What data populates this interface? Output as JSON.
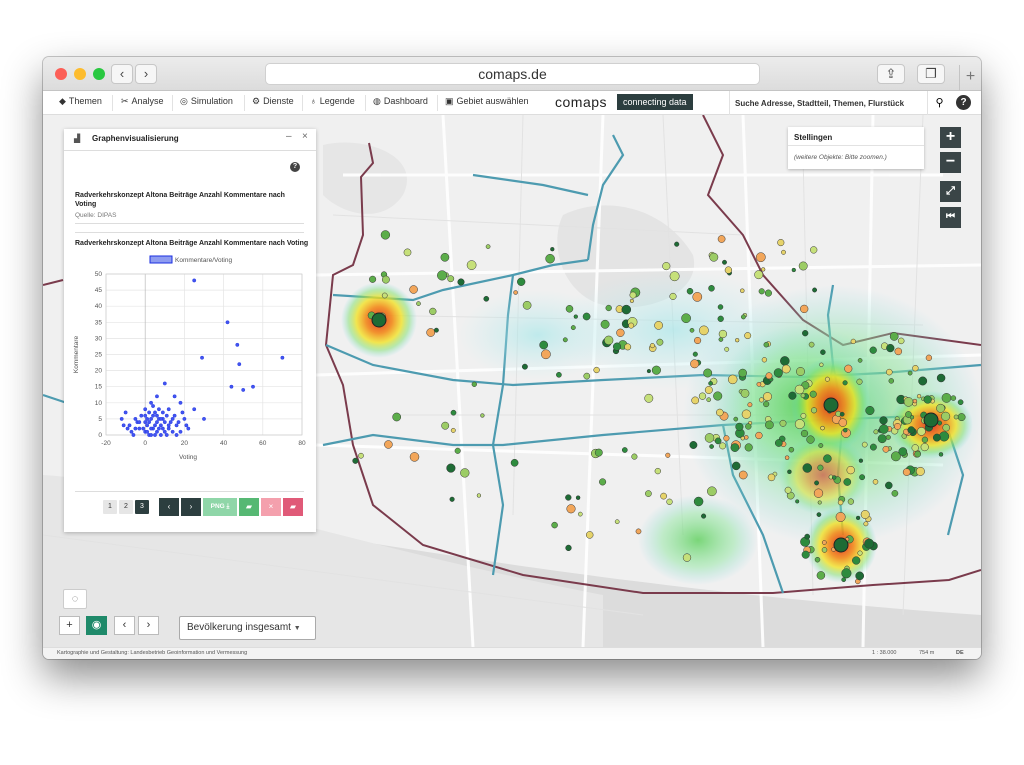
{
  "browser": {
    "url": "comaps.de"
  },
  "nav": {
    "themen": "Themen",
    "analyse": "Analyse",
    "simulation": "Simulation",
    "dienste": "Dienste",
    "legende": "Legende",
    "dashboard": "Dashboard",
    "gebiet": "Gebiet auswählen",
    "logo": "comaps",
    "logo_tag": "connecting data",
    "search_placeholder": "Suche Adresse, Stadtteil, Themen, Flurstück"
  },
  "panel": {
    "title": "Graphenvisualisierung",
    "dataset_title": "Radverkehrskonzept Altona Beiträge Anzahl Kommentare nach Voting",
    "source": "Quelle: DIPAS",
    "chart_title": "Radverkehrskonzept Altona Beiträge Anzahl Kommentare nach Voting",
    "pages": [
      "1",
      "2",
      "3"
    ],
    "active_page": "3",
    "png_label": "PNG"
  },
  "map_legend": {
    "title": "Stellingen",
    "subtitle": "(weitere Objekte: Bitte zoomen.)"
  },
  "bottom": {
    "layer_select": "Bevölkerung insgesamt"
  },
  "footer": {
    "credits": "Kartographie und Gestaltung: Landesbetrieb Geoinformation und Vermessung",
    "scale": "1 : 38.000",
    "distance": "754 m",
    "lang": "DE"
  },
  "colors": {
    "accent": "#1f8a6a",
    "dark": "#2c3e3f",
    "png_btn": "#8fd6a8",
    "delete_btn": "#f4a0ad",
    "folder_btn": "#e05a78",
    "district_line": "#4d9bb0",
    "border_line": "#7a3b4c"
  },
  "chart_data": {
    "type": "scatter",
    "legend": "Kommentare/Voting",
    "xlabel": "Voting",
    "ylabel": "Kommentare",
    "xlim": [
      -20,
      80
    ],
    "ylim": [
      0,
      50
    ],
    "xticks": [
      "-20",
      "0",
      "20",
      "40",
      "60",
      "80"
    ],
    "yticks": [
      "0",
      "5",
      "10",
      "15",
      "20",
      "25",
      "30",
      "35",
      "40",
      "45",
      "50"
    ],
    "points": [
      [
        25,
        48
      ],
      [
        42,
        35
      ],
      [
        47,
        28
      ],
      [
        48,
        22
      ],
      [
        70,
        24
      ],
      [
        29,
        24
      ],
      [
        55,
        15
      ],
      [
        50,
        14
      ],
      [
        44,
        15
      ],
      [
        10,
        16
      ],
      [
        15,
        12
      ],
      [
        18,
        10
      ],
      [
        25,
        8
      ],
      [
        30,
        5
      ],
      [
        -10,
        7
      ],
      [
        -5,
        5
      ],
      [
        0,
        8
      ],
      [
        3,
        10
      ],
      [
        6,
        12
      ],
      [
        -12,
        5
      ],
      [
        -8,
        3
      ],
      [
        -3,
        2
      ],
      [
        0,
        1
      ],
      [
        2,
        0
      ],
      [
        4,
        2
      ],
      [
        6,
        1
      ],
      [
        8,
        3
      ],
      [
        10,
        4
      ],
      [
        12,
        2
      ],
      [
        14,
        1
      ],
      [
        -6,
        0
      ],
      [
        -4,
        4
      ],
      [
        -2,
        6
      ],
      [
        1,
        3
      ],
      [
        3,
        5
      ],
      [
        5,
        7
      ],
      [
        7,
        5
      ],
      [
        9,
        2
      ],
      [
        11,
        6
      ],
      [
        13,
        4
      ],
      [
        16,
        3
      ],
      [
        18,
        1
      ],
      [
        20,
        5
      ],
      [
        22,
        2
      ],
      [
        -1,
        2
      ],
      [
        1,
        1
      ],
      [
        2,
        4
      ],
      [
        4,
        6
      ],
      [
        5,
        3
      ],
      [
        7,
        2
      ],
      [
        8,
        0
      ],
      [
        9,
        7
      ],
      [
        10,
        1
      ],
      [
        12,
        8
      ],
      [
        15,
        6
      ],
      [
        17,
        4
      ],
      [
        19,
        7
      ],
      [
        21,
        3
      ],
      [
        -7,
        1
      ],
      [
        -9,
        2
      ],
      [
        -11,
        3
      ],
      [
        0,
        4
      ],
      [
        3,
        2
      ],
      [
        6,
        4
      ],
      [
        11,
        0
      ],
      [
        14,
        5
      ],
      [
        16,
        0
      ],
      [
        2,
        7
      ],
      [
        4,
        9
      ],
      [
        5,
        0
      ],
      [
        7,
        8
      ],
      [
        9,
        5
      ],
      [
        12,
        3
      ],
      [
        1,
        5
      ],
      [
        -3,
        4
      ],
      [
        -5,
        2
      ],
      [
        0,
        6
      ],
      [
        3,
        0
      ],
      [
        6,
        6
      ],
      [
        8,
        5
      ]
    ]
  }
}
